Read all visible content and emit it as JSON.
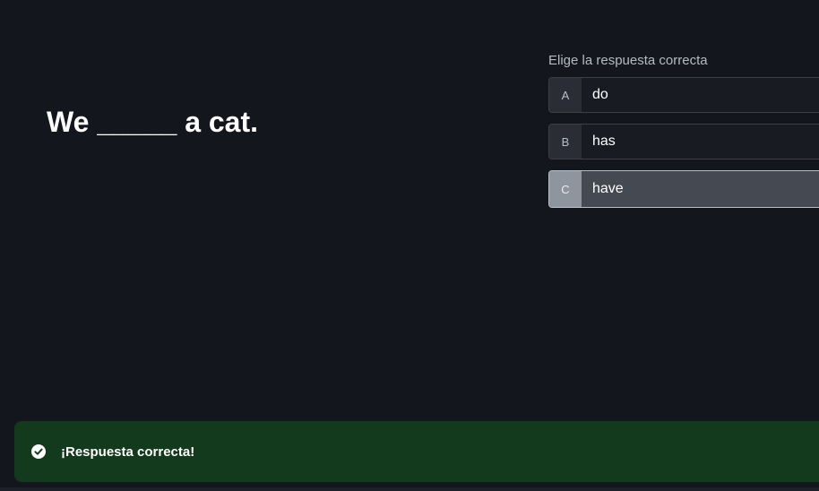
{
  "question": {
    "text": "We _____ a cat."
  },
  "answer_panel": {
    "prompt": "Elige la respuesta correcta",
    "options": [
      {
        "letter": "A",
        "text": "do",
        "selected": false
      },
      {
        "letter": "B",
        "text": "has",
        "selected": false
      },
      {
        "letter": "C",
        "text": "have",
        "selected": true
      }
    ]
  },
  "feedback": {
    "icon": "check-circle-icon",
    "message": "¡Respuesta correcta!",
    "color": "#133a1c"
  }
}
